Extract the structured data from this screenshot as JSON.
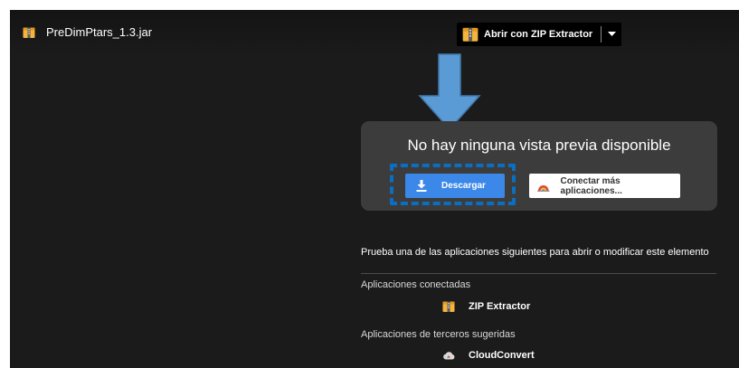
{
  "file": {
    "name": "PreDimPtars_1.3.jar"
  },
  "open_with": {
    "label": "Abrir con ZIP Extractor"
  },
  "preview": {
    "message": "No hay ninguna vista previa disponible",
    "download_label": "Descargar",
    "connect_label": "Conectar más aplicaciones..."
  },
  "suggestions": {
    "heading": "Prueba una de las aplicaciones siguientes para abrir o modificar este elemento",
    "connected_label": "Aplicaciones conectadas",
    "connected_apps": [
      {
        "name": "ZIP Extractor",
        "icon": "zip-extractor-icon"
      }
    ],
    "third_party_label": "Aplicaciones de terceros sugeridas",
    "third_party_apps": [
      {
        "name": "CloudConvert",
        "icon": "cloudconvert-icon"
      }
    ]
  },
  "colors": {
    "viewer_background": "#1b1b1b",
    "card_background": "#3c3c3c",
    "download_button": "#3b88e8",
    "annotation_arrow": "#5b9bd5",
    "annotation_dashes": "#0a6fc2"
  }
}
